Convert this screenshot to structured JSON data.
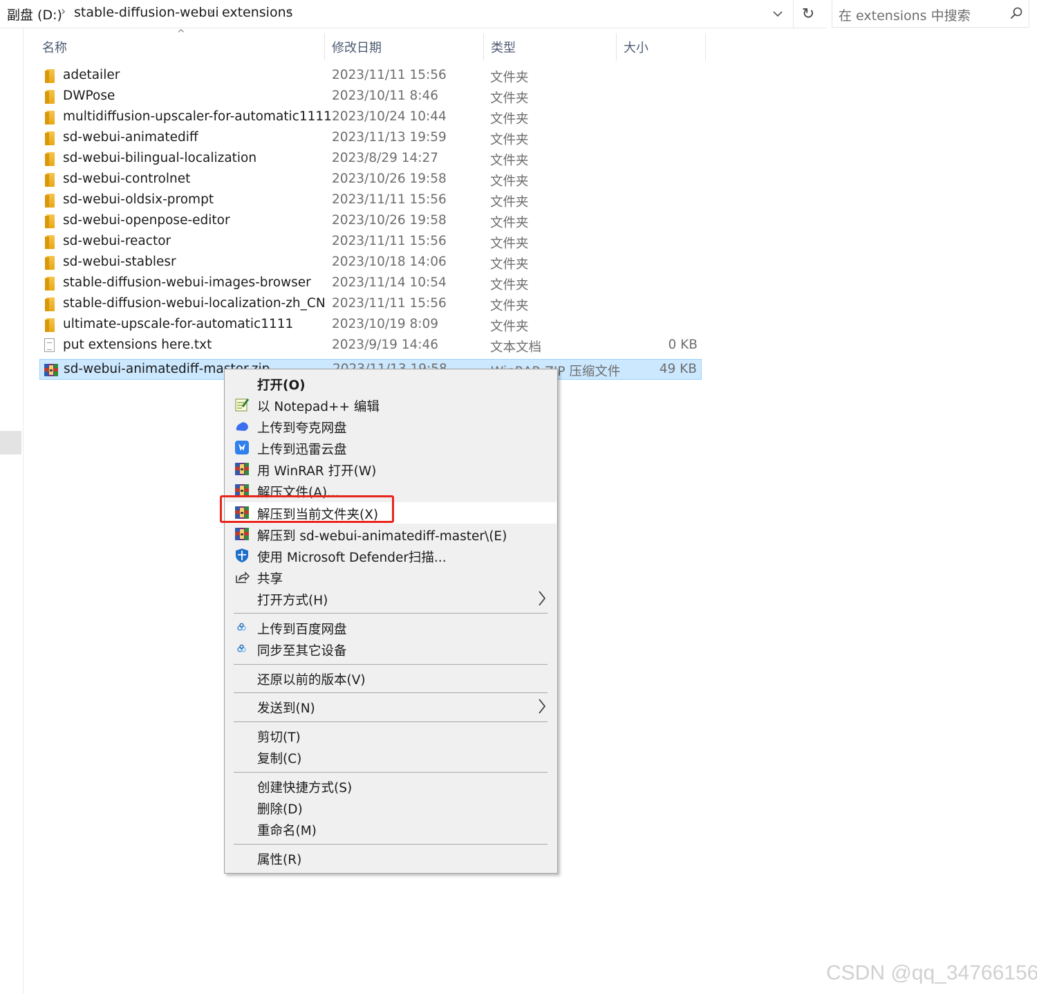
{
  "address": {
    "crumbs": [
      "副盘 (D:)",
      "stable-diffusion-webui",
      "extensions"
    ],
    "search_placeholder": "在 extensions 中搜索",
    "refresh_icon": "refresh-icon",
    "search_icon": "search-icon"
  },
  "columns": {
    "name": "名称",
    "date": "修改日期",
    "type": "类型",
    "size": "大小"
  },
  "files": [
    {
      "name": "adetailer",
      "date": "2023/11/11 15:56",
      "type": "文件夹",
      "size": "",
      "icon": "folder"
    },
    {
      "name": "DWPose",
      "date": "2023/10/11 8:46",
      "type": "文件夹",
      "size": "",
      "icon": "folder"
    },
    {
      "name": "multidiffusion-upscaler-for-automatic1111",
      "date": "2023/10/24 10:44",
      "type": "文件夹",
      "size": "",
      "icon": "folder"
    },
    {
      "name": "sd-webui-animatediff",
      "date": "2023/11/13 19:59",
      "type": "文件夹",
      "size": "",
      "icon": "folder"
    },
    {
      "name": "sd-webui-bilingual-localization",
      "date": "2023/8/29 14:27",
      "type": "文件夹",
      "size": "",
      "icon": "folder"
    },
    {
      "name": "sd-webui-controlnet",
      "date": "2023/10/26 19:58",
      "type": "文件夹",
      "size": "",
      "icon": "folder"
    },
    {
      "name": "sd-webui-oldsix-prompt",
      "date": "2023/11/11 15:56",
      "type": "文件夹",
      "size": "",
      "icon": "folder"
    },
    {
      "name": "sd-webui-openpose-editor",
      "date": "2023/10/26 19:58",
      "type": "文件夹",
      "size": "",
      "icon": "folder"
    },
    {
      "name": "sd-webui-reactor",
      "date": "2023/11/11 15:56",
      "type": "文件夹",
      "size": "",
      "icon": "folder"
    },
    {
      "name": "sd-webui-stablesr",
      "date": "2023/10/18 14:06",
      "type": "文件夹",
      "size": "",
      "icon": "folder"
    },
    {
      "name": "stable-diffusion-webui-images-browser",
      "date": "2023/11/14 10:54",
      "type": "文件夹",
      "size": "",
      "icon": "folder"
    },
    {
      "name": "stable-diffusion-webui-localization-zh_CN",
      "date": "2023/11/11 15:56",
      "type": "文件夹",
      "size": "",
      "icon": "folder"
    },
    {
      "name": "ultimate-upscale-for-automatic1111",
      "date": "2023/10/19 8:09",
      "type": "文件夹",
      "size": "",
      "icon": "folder"
    },
    {
      "name": "put extensions here.txt",
      "date": "2023/9/19 14:46",
      "type": "文本文档",
      "size": "0 KB",
      "icon": "text"
    },
    {
      "name": "sd-webui-animatediff-master.zip",
      "date": "2023/11/13 19:58",
      "type": "WinRAR ZIP 压缩文件",
      "size": "49 KB",
      "icon": "winrar",
      "selected": true
    }
  ],
  "menu": {
    "items": [
      {
        "label": "打开(O)",
        "icon": "",
        "bold": true
      },
      {
        "label": "以 Notepad++ 编辑",
        "icon": "notepadpp-icon"
      },
      {
        "label": "上传到夸克网盘",
        "icon": "quark-cloud-icon"
      },
      {
        "label": "上传到迅雷云盘",
        "icon": "thunder-cloud-icon"
      },
      {
        "label": "用 WinRAR 打开(W)",
        "icon": "winrar-icon"
      },
      {
        "label": "解压文件(A)...",
        "icon": "winrar-icon"
      },
      {
        "label": "解压到当前文件夹(X)",
        "icon": "winrar-icon",
        "hover": true
      },
      {
        "label": "解压到 sd-webui-animatediff-master\\(E)",
        "icon": "winrar-icon"
      },
      {
        "label": "使用 Microsoft Defender扫描...",
        "icon": "defender-shield-icon"
      },
      {
        "label": "共享",
        "icon": "share-icon"
      },
      {
        "label": "打开方式(H)",
        "icon": "",
        "submenu": true
      },
      {
        "label": "上传到百度网盘",
        "icon": "baidu-cloud-icon"
      },
      {
        "label": "同步至其它设备",
        "icon": "baidu-cloud-icon"
      },
      {
        "label": "还原以前的版本(V)",
        "icon": ""
      },
      {
        "label": "发送到(N)",
        "icon": "",
        "submenu": true
      },
      {
        "label": "剪切(T)",
        "icon": ""
      },
      {
        "label": "复制(C)",
        "icon": ""
      },
      {
        "label": "创建快捷方式(S)",
        "icon": ""
      },
      {
        "label": "删除(D)",
        "icon": ""
      },
      {
        "label": "重命名(M)",
        "icon": ""
      },
      {
        "label": "属性(R)",
        "icon": ""
      }
    ]
  },
  "colors": {
    "selection": "#cce8ff",
    "highlight_border": "#e8241b",
    "menu_bg": "#f0f0f0"
  },
  "watermark": "CSDN @qq_34766156"
}
